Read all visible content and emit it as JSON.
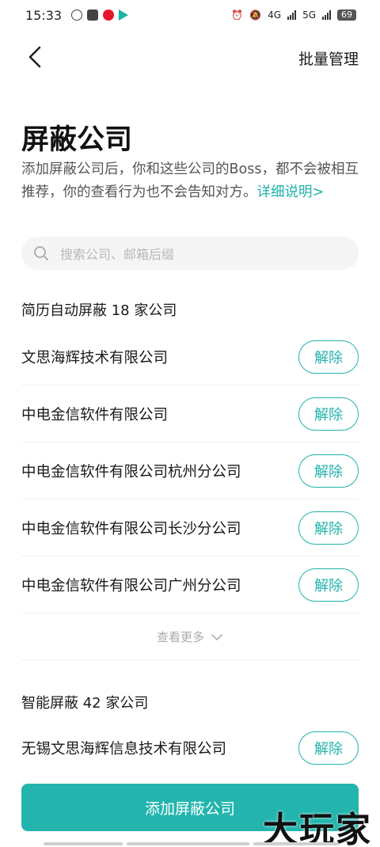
{
  "status_bar": {
    "time": "15:33",
    "network_1": "4G",
    "network_2": "5G",
    "battery": "69"
  },
  "header": {
    "batch_manage": "批量管理"
  },
  "title": "屏蔽公司",
  "description": {
    "text": "添加屏蔽公司后，你和这些公司的Boss，都不会被相互推荐，你的查看行为也不会告知对方。",
    "link": "详细说明>"
  },
  "search": {
    "placeholder": "搜索公司、邮箱后缀"
  },
  "auto_section": {
    "title": "简历自动屏蔽 18 家公司",
    "companies": [
      {
        "name": "文思海辉技术有限公司",
        "action": "解除"
      },
      {
        "name": "中电金信软件有限公司",
        "action": "解除"
      },
      {
        "name": "中电金信软件有限公司杭州分公司",
        "action": "解除"
      },
      {
        "name": "中电金信软件有限公司长沙分公司",
        "action": "解除"
      },
      {
        "name": "中电金信软件有限公司广州分公司",
        "action": "解除"
      }
    ],
    "see_more": "查看更多"
  },
  "smart_section": {
    "title": "智能屏蔽 42 家公司",
    "companies": [
      {
        "name": "无锡文思海辉信息技术有限公司",
        "action": "解除"
      }
    ]
  },
  "add_button": "添加屏蔽公司",
  "watermark": "大玩家",
  "colors": {
    "accent": "#23b5ad",
    "text": "#1a1a1a",
    "muted": "#555555"
  }
}
